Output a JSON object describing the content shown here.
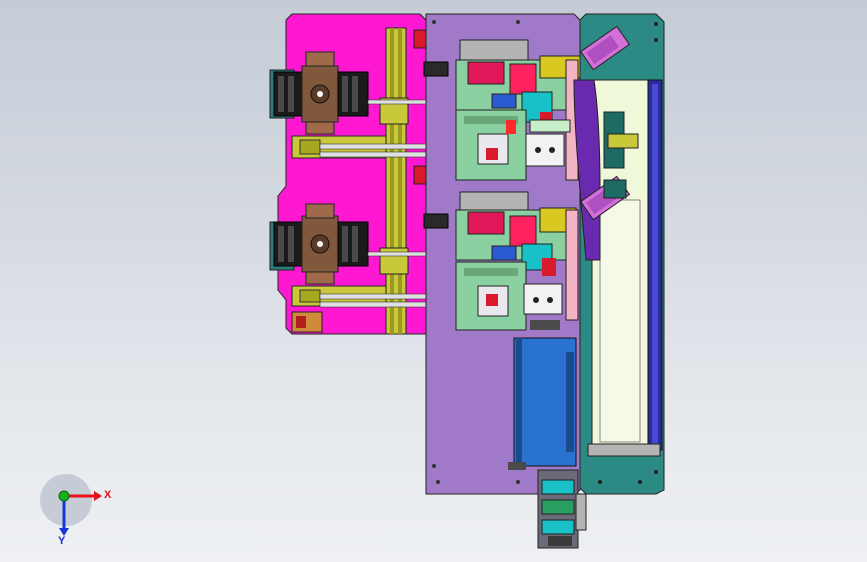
{
  "window": {
    "background_top": "#c5ccd6",
    "background_bottom": "#eef0f3"
  },
  "triad": {
    "x_label": "X",
    "y_label": "Y",
    "x_color": "#e8101a",
    "y_color": "#1a33d8",
    "origin_color": "#19b020"
  },
  "model": {
    "plate_colors": {
      "feeder_plate": "#ff18d2",
      "base_plate": "#a07ac8",
      "right_plate": "#2c8a84",
      "conveyor": "#f0f8da",
      "conveyor_rail": "#2a2aa0",
      "motor_box": "#2a72d0",
      "grip_block": "#80583c",
      "rail": "#c8c83a"
    }
  }
}
